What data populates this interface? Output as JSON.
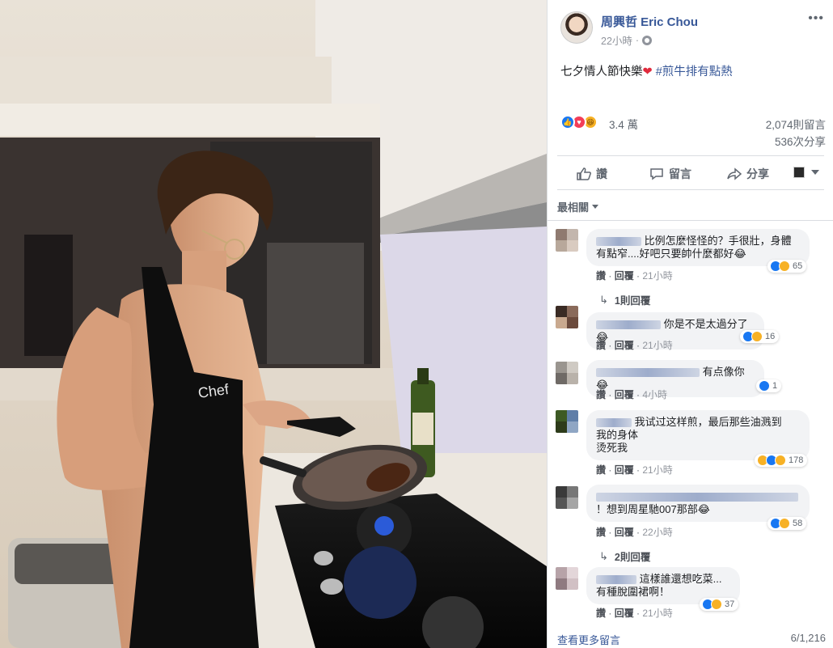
{
  "post": {
    "author": "周興哲 Eric Chou",
    "time": "22小時",
    "caption_text": "七夕情人節快樂",
    "caption_hashtag": "#煎牛排有點熱",
    "photo_apron_text": "Chef"
  },
  "stats": {
    "reaction_count": "3.4 萬",
    "comment_count": "2,074則留言",
    "share_count": "536次分享"
  },
  "actions": {
    "like": "讚",
    "comment": "留言",
    "share": "分享"
  },
  "sort_label": "最相關",
  "comment_meta": {
    "like": "讚",
    "reply": "回覆"
  },
  "comments": [
    {
      "text_line1": "比例怎麼怪怪的？手很壯，身體",
      "text_line2": "有點窄....好吧只要帥什麼都好😂",
      "time": "21小時",
      "reactions": "65",
      "replies": "1則回覆"
    },
    {
      "text_line1": "你是不是太過分了😂",
      "time": "21小時",
      "reactions": "16"
    },
    {
      "text_line1": "有点像你😂",
      "time": "4小時",
      "reactions": "1"
    },
    {
      "text_line1": "我试过这样煎，最后那些油溅到",
      "text_line2": "我的身体",
      "text_line3": "烫死我",
      "time": "21小時",
      "reactions": "178"
    },
    {
      "text_line1": "！想到周星馳007那部😂",
      "time": "22小時",
      "reactions": "58",
      "replies": "2則回覆"
    },
    {
      "text_line1": "這樣誰還想吃菜...",
      "text_line2": "有種脫圍裙啊！",
      "time": "21小時",
      "reactions": "37"
    }
  ],
  "footer": {
    "more_comments": "查看更多留言",
    "page_count": "6/1,216"
  },
  "colors": {
    "link": "#385898",
    "like_blue": "#1877f2",
    "love_red": "#f33e58",
    "haha_yellow": "#f7b125"
  }
}
